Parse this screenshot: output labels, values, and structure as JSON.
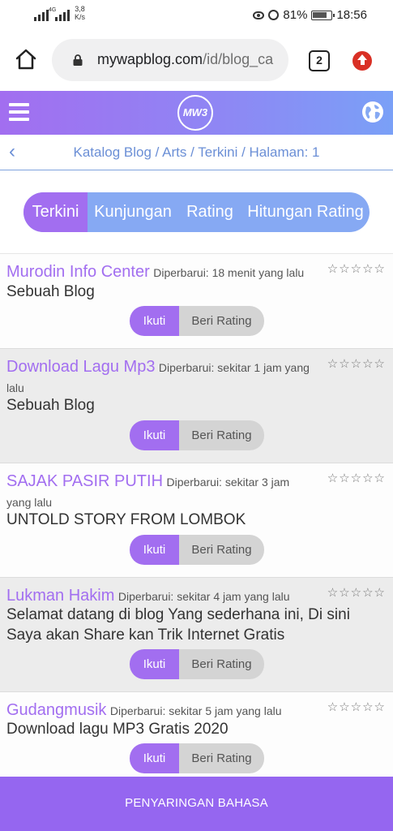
{
  "status_bar": {
    "network_label": "4G",
    "speed_value": "3,8",
    "speed_unit": "K/s",
    "battery": "81%",
    "time": "18:56"
  },
  "browser": {
    "url_main": "mywapblog.com",
    "url_path": "/id/blog_ca",
    "tab_count": "2"
  },
  "header": {
    "logo_text": "MW3"
  },
  "breadcrumb": {
    "text": "Katalog Blog / Arts / Terkini / Halaman: 1"
  },
  "sort_tabs": [
    {
      "label": "Terkini",
      "active": true
    },
    {
      "label": "Kunjungan",
      "active": false
    },
    {
      "label": "Rating",
      "active": false
    },
    {
      "label": "Hitungan Rating",
      "active": false
    }
  ],
  "entries": [
    {
      "title": "Murodin Info Center",
      "updated": "Diperbarui: 18 menit yang lalu",
      "description": "Sebuah Blog",
      "stars": "☆☆☆☆☆",
      "follow_label": "Ikuti",
      "rate_label": "Beri Rating"
    },
    {
      "title": "Download Lagu Mp3",
      "updated": "Diperbarui: sekitar 1 jam yang lalu",
      "description": "Sebuah Blog",
      "stars": "☆☆☆☆☆",
      "follow_label": "Ikuti",
      "rate_label": "Beri Rating"
    },
    {
      "title": "SAJAK PASIR PUTIH",
      "updated": "Diperbarui: sekitar 3 jam yang lalu",
      "description": "UNTOLD STORY FROM LOMBOK",
      "stars": "☆☆☆☆☆",
      "follow_label": "Ikuti",
      "rate_label": "Beri Rating"
    },
    {
      "title": "Lukman Hakim",
      "updated": "Diperbarui: sekitar 4 jam yang lalu",
      "description": "Selamat datang di blog Yang sederhana ini, Di sini Saya akan Share kan Trik Internet Gratis",
      "stars": "☆☆☆☆☆",
      "follow_label": "Ikuti",
      "rate_label": "Beri Rating"
    },
    {
      "title": "Gudangmusik",
      "updated": "Diperbarui: sekitar 5 jam yang lalu",
      "description": "Download lagu MP3 Gratis 2020",
      "stars": "☆☆☆☆☆",
      "follow_label": "Ikuti",
      "rate_label": "Beri Rating"
    }
  ],
  "footer": {
    "label": "PENYARINGAN BAHASA"
  },
  "colors": {
    "accent_purple": "#a26ef0",
    "accent_blue": "#86a9f3",
    "link_blue": "#6b8fd6",
    "update_red": "#d93025"
  }
}
